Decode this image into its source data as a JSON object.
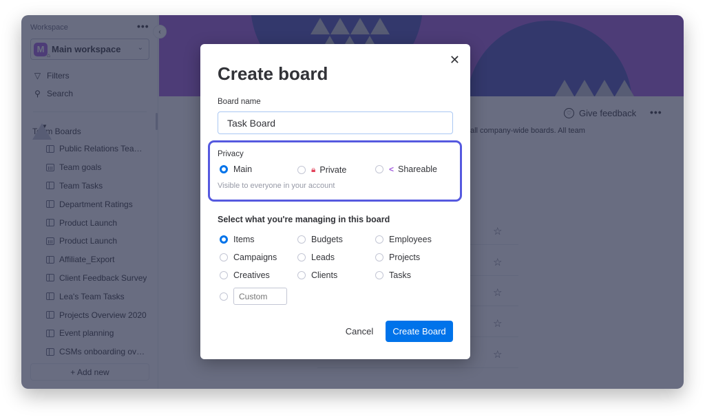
{
  "sidebar": {
    "workspace_label": "Workspace",
    "more_icon": "more-dots-icon",
    "workspace_initial": "M",
    "workspace_name": "Main workspace",
    "filters_label": "Filters",
    "search_label": "Search",
    "folder_label": "Team Boards",
    "boards": [
      {
        "label": "Public Relations Team - ...",
        "icon": "table"
      },
      {
        "label": "Team goals",
        "icon": "dash"
      },
      {
        "label": "Team Tasks",
        "icon": "table"
      },
      {
        "label": "Department Ratings",
        "icon": "table"
      },
      {
        "label": "Product Launch",
        "icon": "table"
      },
      {
        "label": "Product Launch",
        "icon": "dash"
      },
      {
        "label": "Affiliate_Export",
        "icon": "table"
      },
      {
        "label": "Client Feedback Survey",
        "icon": "table"
      },
      {
        "label": "Lea's Team Tasks",
        "icon": "table"
      },
      {
        "label": "Projects Overview 2020",
        "icon": "table"
      },
      {
        "label": "Event planning",
        "icon": "table"
      },
      {
        "label": "CSMs onboarding overv...",
        "icon": "table"
      }
    ],
    "add_new_label": "+ Add new"
  },
  "main": {
    "feedback_label": "Give feedback",
    "description_fragment": "all company-wide boards. All team",
    "star_rows": 5
  },
  "modal": {
    "title": "Create board",
    "board_name_label": "Board name",
    "board_name_value": "Task Board",
    "privacy_label": "Privacy",
    "privacy_options": [
      {
        "label": "Main",
        "selected": true,
        "icon": ""
      },
      {
        "label": "Private",
        "selected": false,
        "icon": "lock-icon"
      },
      {
        "label": "Shareable",
        "selected": false,
        "icon": "share-icon"
      }
    ],
    "privacy_hint": "Visible to everyone in your account",
    "manage_title": "Select what you're managing in this board",
    "manage_options": [
      {
        "label": "Items",
        "selected": true
      },
      {
        "label": "Budgets",
        "selected": false
      },
      {
        "label": "Employees",
        "selected": false
      },
      {
        "label": "Campaigns",
        "selected": false
      },
      {
        "label": "Leads",
        "selected": false
      },
      {
        "label": "Projects",
        "selected": false
      },
      {
        "label": "Creatives",
        "selected": false
      },
      {
        "label": "Clients",
        "selected": false
      },
      {
        "label": "Tasks",
        "selected": false
      }
    ],
    "custom_placeholder": "Custom",
    "cancel_label": "Cancel",
    "create_label": "Create Board"
  },
  "colors": {
    "accent": "#0073ea",
    "highlight": "#5559df",
    "private_icon": "#e2445c",
    "share_icon": "#a25ddc"
  }
}
